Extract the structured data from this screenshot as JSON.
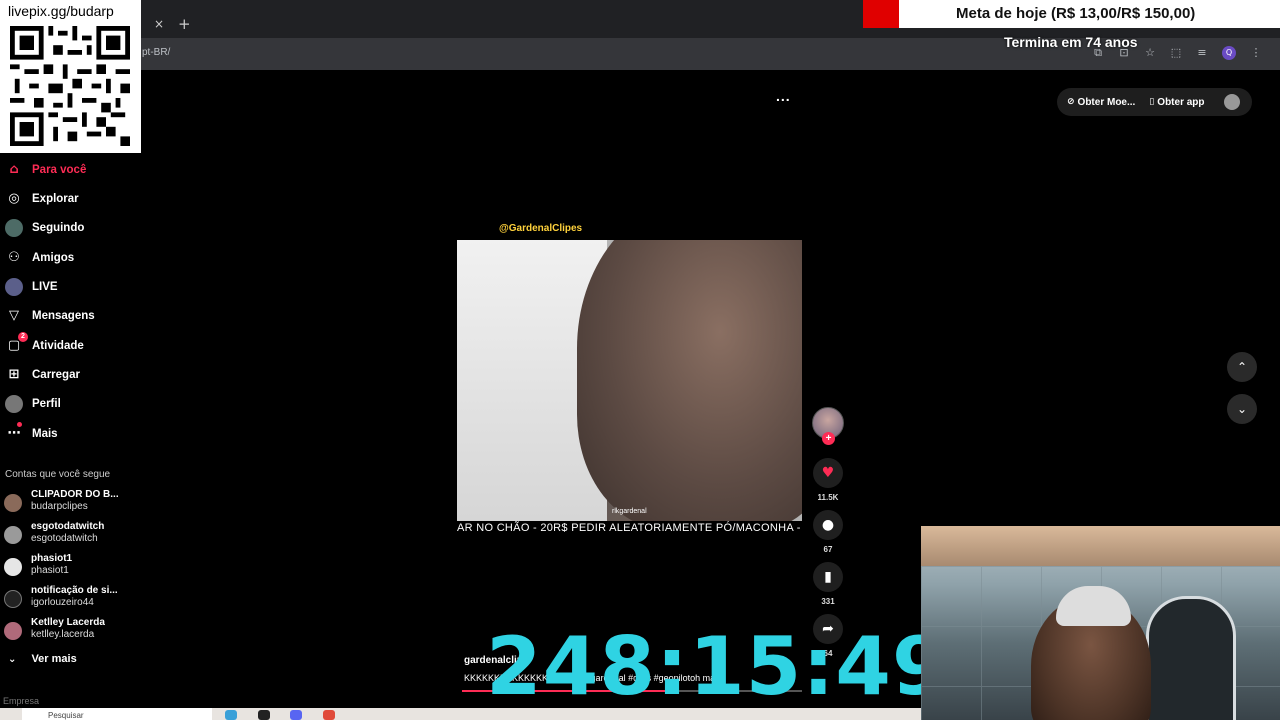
{
  "overlay": {
    "donation_url": "livepix.gg/budarp",
    "goal_text": "Meta de hoje (R$ 13,00/R$ 150,00)",
    "goal_deadline": "Termina em 74 anos",
    "timer": "248:15:49"
  },
  "browser": {
    "url_fragment": "pt-BR/",
    "tab_close": "×",
    "tab_add": "+"
  },
  "header": {
    "get_coins": "Obter Moe...",
    "get_app": "Obter app",
    "more": "..."
  },
  "sidebar": {
    "items": [
      {
        "label": "Para você",
        "icon": "home-icon"
      },
      {
        "label": "Explorar",
        "icon": "compass-icon"
      },
      {
        "label": "Seguindo",
        "icon": "avatar-icon"
      },
      {
        "label": "Amigos",
        "icon": "friends-icon"
      },
      {
        "label": "LIVE",
        "icon": "avatar-icon"
      },
      {
        "label": "Mensagens",
        "icon": "send-icon"
      },
      {
        "label": "Atividade",
        "icon": "activity-icon",
        "badge": "2"
      },
      {
        "label": "Carregar",
        "icon": "upload-icon"
      },
      {
        "label": "Perfil",
        "icon": "avatar-icon"
      },
      {
        "label": "Mais",
        "icon": "more-icon"
      }
    ],
    "following_title": "Contas que você segue",
    "accounts": [
      {
        "name": "CLIPADOR DO B...",
        "handle": "budarpclipes"
      },
      {
        "name": "esgotodatwitch",
        "handle": "esgotodatwitch"
      },
      {
        "name": "phasiot1",
        "handle": "phasiot1"
      },
      {
        "name": "notificação de si...",
        "handle": "igorlouzeiro44"
      },
      {
        "name": "Ketlley Lacerda",
        "handle": "ketlley.lacerda"
      }
    ],
    "see_more": "Ver mais",
    "footer": "Empresa"
  },
  "video": {
    "top_handle": "@GardenalClipes",
    "watermark": "rlkgardenal",
    "caption_strip": "AR NO CHÃO - 20R$ PEDIR ALEATORIAMENTE PÓ/MACONHA -",
    "author": "gardenalclip",
    "description": "KKKKKKKKKKKKKKKKK... #rlkgardenal #clips #geopilotoh  mais",
    "progress": 0.62
  },
  "actions": {
    "likes": "11.5K",
    "comments": "67",
    "saves": "331",
    "shares": "64"
  },
  "taskbar": {
    "search_placeholder": "Pesquisar"
  },
  "colors": {
    "accent": "#fe2c55",
    "timer": "#2fd3e3",
    "goal_red": "#e00000"
  }
}
